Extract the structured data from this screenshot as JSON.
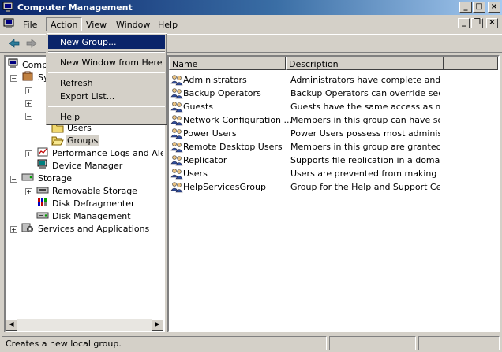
{
  "window": {
    "title": "Computer Management",
    "minimize": "_",
    "maximize": "□",
    "close": "×"
  },
  "menubar": {
    "items": [
      "File",
      "Action",
      "View",
      "Window",
      "Help"
    ]
  },
  "mdi_controls": {
    "minimize": "_",
    "restore": "❐",
    "close": "×"
  },
  "action_menu": {
    "items": [
      "New Group...",
      "New Window from Here",
      "Refresh",
      "Export List...",
      "Help"
    ],
    "highlighted": "New Group..."
  },
  "tree": {
    "root": "Compu",
    "system_tools": "Sy",
    "users": "Users",
    "groups": "Groups",
    "perf_logs": "Performance Logs and Alerts",
    "device_manager": "Device Manager",
    "storage": "Storage",
    "removable_storage": "Removable Storage",
    "disk_defragmenter": "Disk Defragmenter",
    "disk_management": "Disk Management",
    "services_apps": "Services and Applications"
  },
  "list": {
    "columns": [
      "Name",
      "Description"
    ],
    "rows": [
      {
        "name": "Administrators",
        "description": "Administrators have complete and u..."
      },
      {
        "name": "Backup Operators",
        "description": "Backup Operators can override secu..."
      },
      {
        "name": "Guests",
        "description": "Guests have the same access as me..."
      },
      {
        "name": "Network Configuration ...",
        "description": "Members in this group can have som..."
      },
      {
        "name": "Power Users",
        "description": "Power Users possess most administr..."
      },
      {
        "name": "Remote Desktop Users",
        "description": "Members in this group are granted t..."
      },
      {
        "name": "Replicator",
        "description": "Supports file replication in a domain"
      },
      {
        "name": "Users",
        "description": "Users are prevented from making ac..."
      },
      {
        "name": "HelpServicesGroup",
        "description": "Group for the Help and Support Center"
      }
    ]
  },
  "statusbar": {
    "text": "Creates a new local group."
  },
  "colors": {
    "title_start": "#0a246a",
    "title_end": "#a6caf0",
    "menu_highlight": "#0a246a",
    "face": "#d4d0c8"
  }
}
